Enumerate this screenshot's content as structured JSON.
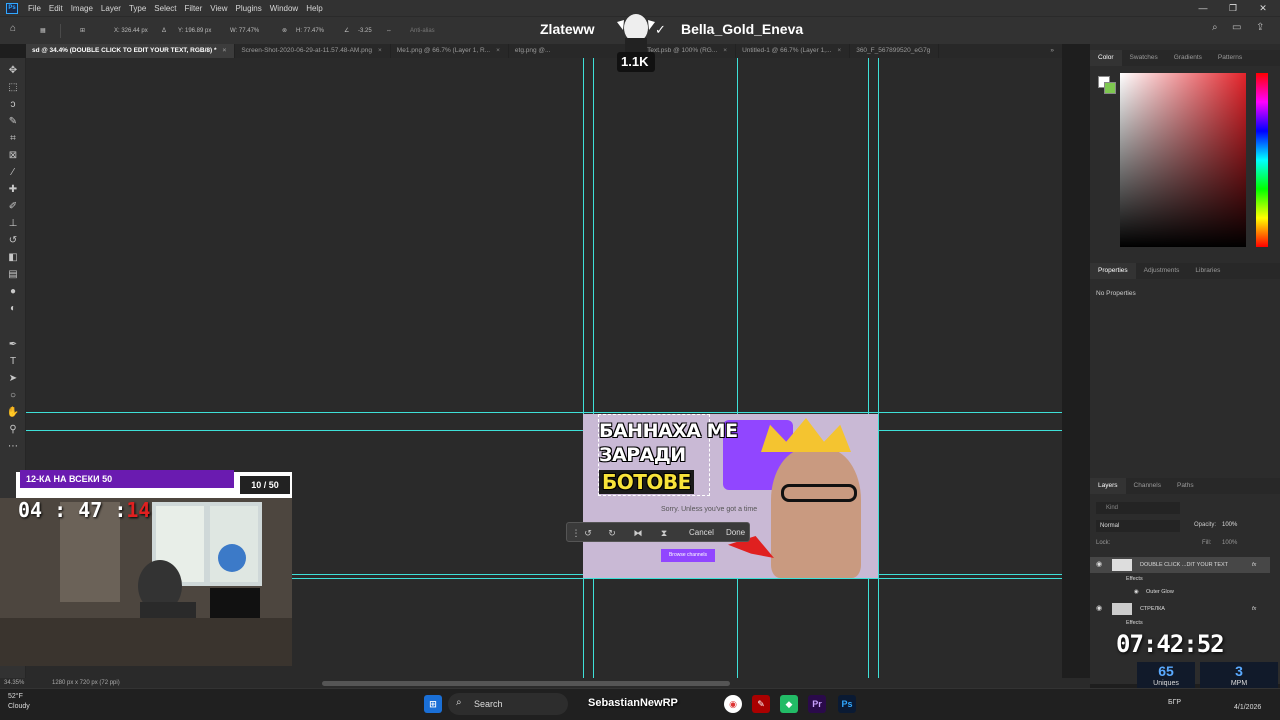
{
  "menubar": {
    "logo": "Ps",
    "items": [
      "File",
      "Edit",
      "Image",
      "Layer",
      "Type",
      "Select",
      "Filter",
      "View",
      "Plugins",
      "Window",
      "Help"
    ],
    "window_controls": [
      "—",
      "❐",
      "✕"
    ]
  },
  "options": {
    "x": "X: 326.44 px",
    "y": "Y: 196.89 px",
    "w": "W: 77.47%",
    "h": "H: 77.47%",
    "angle": "-3.25",
    "antialias": "Anti-alias"
  },
  "overlay_header": {
    "left_name": "Zlateww",
    "right_name": "Bella_Gold_Eneva",
    "mascot_badge": "1.1K"
  },
  "tabs": [
    {
      "label": "sd @ 34.4% (DOUBLE CLICK TO EDIT YOUR TEXT, RGB/8) *",
      "active": true
    },
    {
      "label": "Screen-Shot-2020-06-29-at-11.57.48-AM.png",
      "active": false
    },
    {
      "label": "Me1.png @ 66.7% (Layer 1, R...",
      "active": false
    },
    {
      "label": "etg.png @...",
      "active": false
    },
    {
      "label": "Top Text.psb @ 100% (RG...",
      "active": false
    },
    {
      "label": "Untitled-1 @ 66.7% (Layer 1,...",
      "active": false
    },
    {
      "label": "360_F_567899520_eG7g",
      "active": false
    }
  ],
  "tools": [
    "move-tool",
    "marquee-tool",
    "lasso-tool",
    "quick-select-tool",
    "crop-tool",
    "frame-tool",
    "eyedropper-tool",
    "healing-tool",
    "brush-tool",
    "stamp-tool",
    "history-brush-tool",
    "eraser-tool",
    "gradient-tool",
    "blur-tool",
    "dodge-tool",
    "pen-tool",
    "type-tool",
    "path-select-tool",
    "shape-tool",
    "hand-tool",
    "zoom-tool",
    "more-tool"
  ],
  "artwork": {
    "line1": "БАННАХА МЕ",
    "line2": "ЗАРАДИ",
    "line3": "БОТОВЕ",
    "sorry": "Sorry. Unless you've got a time",
    "browse": "Browse channels"
  },
  "transform": {
    "cancel": "Cancel",
    "done": "Done"
  },
  "panels": {
    "color_tabs": [
      "Color",
      "Swatches",
      "Gradients",
      "Patterns"
    ],
    "prop_tabs": [
      "Properties",
      "Adjustments",
      "Libraries"
    ],
    "no_properties": "No Properties",
    "layer_tabs": [
      "Layers",
      "Channels",
      "Paths"
    ],
    "kind": "Kind",
    "blend": "Normal",
    "opacity_label": "Opacity:",
    "opacity": "100%",
    "lock_label": "Lock:",
    "fill_label": "Fill:",
    "fill": "100%",
    "fg_color": "#ffffff",
    "bg_color": "#7ec850"
  },
  "layers": [
    {
      "name": "DOUBLE CLICK ...DIT YOUR TEXT",
      "fx": "fx",
      "selected": true,
      "indent": 0
    },
    {
      "name": "Effects",
      "fx": "",
      "selected": false,
      "indent": 1
    },
    {
      "name": "Outer Glow",
      "fx": "",
      "selected": false,
      "indent": 2
    },
    {
      "name": "СТРЕЛКА",
      "fx": "fx",
      "selected": false,
      "indent": 0
    },
    {
      "name": "Effects",
      "fx": "",
      "selected": false,
      "indent": 1
    }
  ],
  "webcam": {
    "header": "12-КА НА ВСЕКИ 50",
    "count": "10 / 50",
    "timer": "04 : 47 :",
    "timer_red": "14"
  },
  "stream_stats": {
    "clock": "07:42:52",
    "uniques_value": "65",
    "uniques_label": "Uniques",
    "mpm_value": "3",
    "mpm_label": "MPM"
  },
  "status": {
    "zoom": "34.35%",
    "doc_size": "1280 px x 720 px (72 ppi)"
  },
  "taskbar": {
    "weather_temp": "52°F",
    "weather_desc": "Cloudy",
    "search": "Search",
    "streamer_overlay": "SebastianNewRP",
    "lang": "БГР",
    "date": "4/1/2026"
  }
}
